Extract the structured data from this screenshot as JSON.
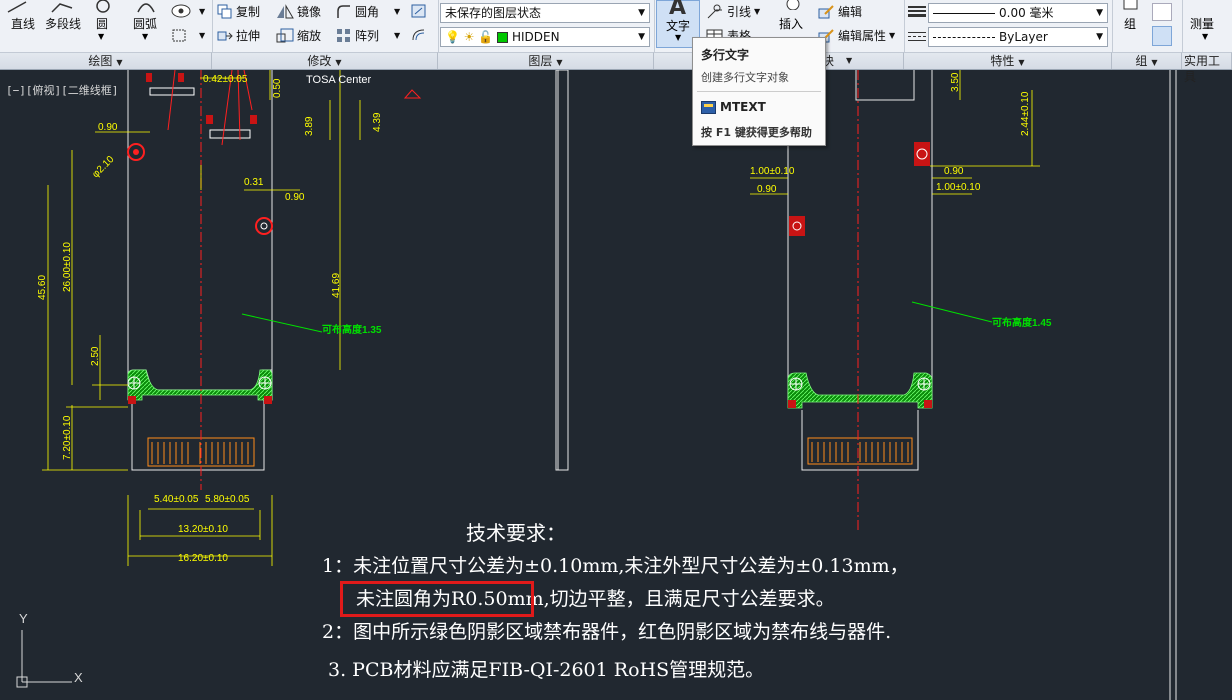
{
  "ribbon": {
    "draw": {
      "line": "直线",
      "polyline": "多段线",
      "circle": "圆",
      "arc": "圆弧",
      "group_label": "绘图"
    },
    "modify": {
      "copy": "复制",
      "mirror": "镜像",
      "fillet": "圆角",
      "stretch": "拉伸",
      "scale": "缩放",
      "array": "阵列",
      "group_label": "修改"
    },
    "layers": {
      "layer_state": "未保存的图层状态",
      "current_layer": "HIDDEN",
      "current_layer_color": "#00c800",
      "group_label": "图层"
    },
    "annotation": {
      "text": "文字",
      "leader": "引线",
      "table": "表格"
    },
    "block": {
      "insert": "插入",
      "edit": "编辑",
      "edit_attributes": "编辑属性",
      "group_label": "块"
    },
    "properties": {
      "lineweight": "0.00 毫米",
      "linetype": "ByLayer",
      "group_label": "特性"
    },
    "groups": {
      "group": "组",
      "group_label": "组"
    },
    "utilities": {
      "measure": "测量",
      "group_label": "实用工具"
    }
  },
  "tooltip": {
    "title": "多行文字",
    "description": "创建多行文字对象",
    "command": "MTEXT",
    "help": "按 F1 键获得更多帮助"
  },
  "canvas": {
    "viewport_label": "[−][俯视][二维线框]",
    "background": "#212830",
    "labels": {
      "tosa": "TOSA  Center",
      "keepout_left": "可布高度1.35",
      "keepout_right": "可布高度1.45"
    },
    "dims_left": {
      "d_42": "0.42±0.05",
      "d_050": "0.50",
      "d_389": "3.89",
      "d_439": "4.39",
      "d_090a": "0.90",
      "d_phi210": "φ2.10",
      "d_031": "0.31",
      "d_090b": "0.90",
      "d_4560": "45.60",
      "d_2600": "26.00±0.10",
      "d_4169": "41.69",
      "d_250": "2.50",
      "d_720": "7.20±0.10",
      "d_540": "5.40±0.05",
      "d_580": "5.80±0.05",
      "d_1320": "13.20±0.10",
      "d_1620": "16.20±0.10"
    },
    "dims_right": {
      "d_350": "3.50",
      "d_244": "2.44±0.10",
      "d_100a": "1.00±0.10",
      "d_090c": "0.90",
      "d_090d": "0.90",
      "d_100b": "1.00±0.10"
    }
  },
  "notes": {
    "title": "技术要求：",
    "line1": "1：未注位置尺寸公差为±0.10mm,未注外型尺寸公差为±0.13mm，",
    "line1b": "未注圆角为R0.50mm,切边平整，且满足尺寸公差要求。",
    "line2": "2：图中所示绿色阴影区域禁布器件，红色阴影区域为禁布线与器件.",
    "line3": "3. PCB材料应满足FIB-QI-2601 RoHS管理规范。"
  },
  "ucs": {
    "x": "X",
    "y": "Y"
  }
}
